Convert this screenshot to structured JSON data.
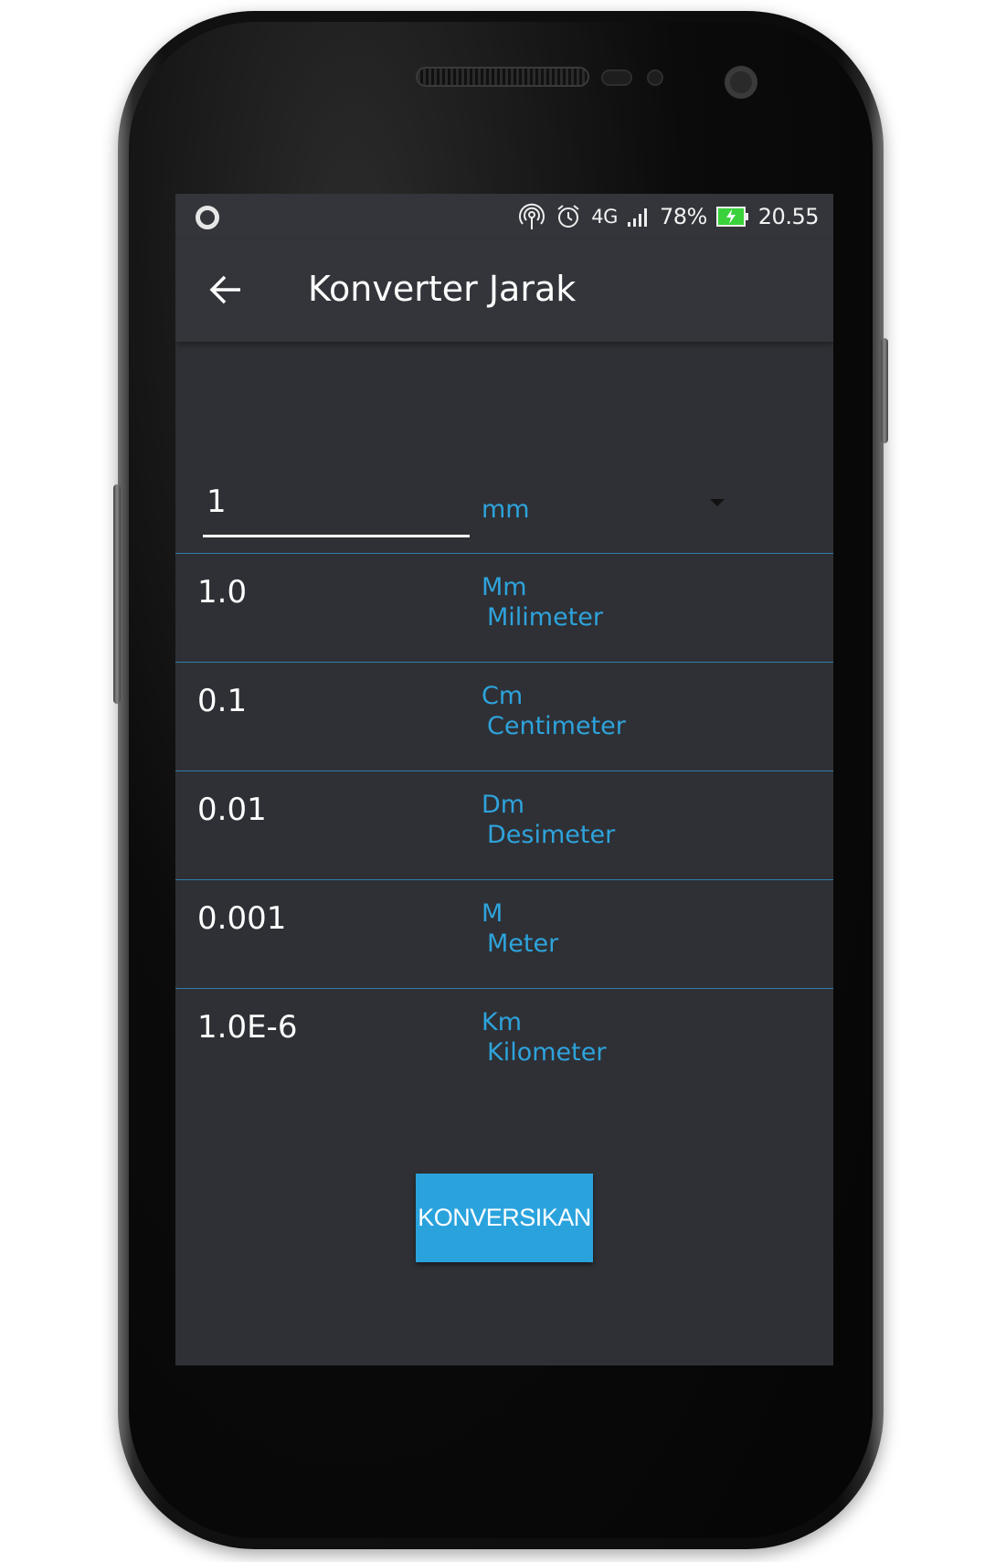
{
  "status_bar": {
    "network": "4G",
    "battery": "78%",
    "time": "20.55",
    "battery_color": "#3bd13b"
  },
  "toolbar": {
    "title": "Konverter Jarak"
  },
  "converter": {
    "input_value": "1",
    "selected_unit": "mm",
    "results": [
      {
        "value": "1.0",
        "unit_short": "Mm",
        "unit_name": "Milimeter"
      },
      {
        "value": "0.1",
        "unit_short": "Cm",
        "unit_name": "Centimeter"
      },
      {
        "value": "0.01",
        "unit_short": "Dm",
        "unit_name": "Desimeter"
      },
      {
        "value": "0.001",
        "unit_short": "M",
        "unit_name": "Meter"
      },
      {
        "value": "1.0E-6",
        "unit_short": "Km",
        "unit_name": "Kilometer"
      }
    ],
    "button_label": "KONVERSIKAN"
  },
  "colors": {
    "accent": "#2aa3dd",
    "background": "#2e3035",
    "divider": "#2f7ea6"
  }
}
